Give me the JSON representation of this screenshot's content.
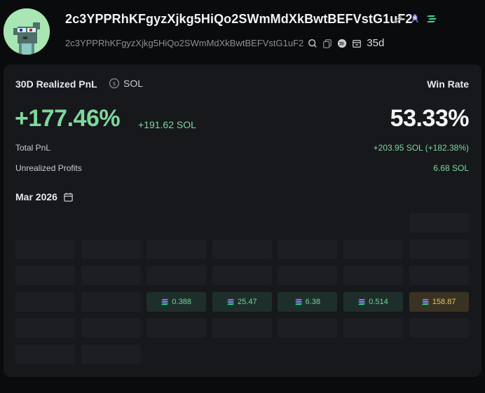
{
  "wallet": {
    "title": "2c3YPPRhKFgyzXjkg5HiQo2SWmMdXkBwtBEFVstG1uF2",
    "address": "2c3YPPRhKFgyzXjkg5HiQo2SWmMdXkBwtBEFVstG1uF2",
    "age": "35d"
  },
  "pnl": {
    "title": "30D Realized PnL",
    "currency": "SOL",
    "percent": "+177.46%",
    "sol": "+191.62 SOL",
    "total_label": "Total PnL",
    "total_value": "+203.95 SOL (+182.38%)",
    "unrealized_label": "Unrealized Profits",
    "unrealized_value": "6.68 SOL"
  },
  "win": {
    "title": "Win Rate",
    "value": "53.33%"
  },
  "calendar": {
    "month": "Mar 2026",
    "cells": [
      {
        "row": 0,
        "col": 6,
        "label": ""
      },
      {
        "row": 1,
        "col": 0,
        "label": ""
      },
      {
        "row": 1,
        "col": 1,
        "label": ""
      },
      {
        "row": 1,
        "col": 2,
        "label": ""
      },
      {
        "row": 1,
        "col": 3,
        "label": ""
      },
      {
        "row": 1,
        "col": 4,
        "label": ""
      },
      {
        "row": 1,
        "col": 5,
        "label": ""
      },
      {
        "row": 1,
        "col": 6,
        "label": ""
      },
      {
        "row": 2,
        "col": 0,
        "label": ""
      },
      {
        "row": 2,
        "col": 1,
        "label": ""
      },
      {
        "row": 2,
        "col": 2,
        "label": ""
      },
      {
        "row": 2,
        "col": 3,
        "label": ""
      },
      {
        "row": 2,
        "col": 4,
        "label": ""
      },
      {
        "row": 2,
        "col": 5,
        "label": ""
      },
      {
        "row": 2,
        "col": 6,
        "label": ""
      },
      {
        "row": 3,
        "col": 0,
        "label": ""
      },
      {
        "row": 3,
        "col": 1,
        "label": ""
      },
      {
        "row": 3,
        "col": 2,
        "label": "0.388",
        "style": "val"
      },
      {
        "row": 3,
        "col": 3,
        "label": "25.47",
        "style": "val"
      },
      {
        "row": 3,
        "col": 4,
        "label": "6.38",
        "style": "val"
      },
      {
        "row": 3,
        "col": 5,
        "label": "0.514",
        "style": "val"
      },
      {
        "row": 3,
        "col": 6,
        "label": "158.87",
        "style": "hot"
      },
      {
        "row": 4,
        "col": 0,
        "label": ""
      },
      {
        "row": 4,
        "col": 1,
        "label": ""
      },
      {
        "row": 4,
        "col": 2,
        "label": ""
      },
      {
        "row": 4,
        "col": 3,
        "label": ""
      },
      {
        "row": 4,
        "col": 4,
        "label": ""
      },
      {
        "row": 4,
        "col": 5,
        "label": ""
      },
      {
        "row": 4,
        "col": 6,
        "label": ""
      },
      {
        "row": 5,
        "col": 0,
        "label": ""
      },
      {
        "row": 5,
        "col": 1,
        "label": ""
      }
    ]
  },
  "icons": {
    "edit": "pencil-icon",
    "rocket": "rocket-icon",
    "menu": "solana-bars-icon",
    "search": "search-icon",
    "copy": "copy-icon",
    "chain": "chain-icon",
    "wallet_age": "calendar-box-icon",
    "currency": "currency-icon",
    "month_picker": "calendar-icon"
  },
  "colors": {
    "green": "#7ed99b",
    "gold": "#e3c76a",
    "card": "#16181c"
  }
}
